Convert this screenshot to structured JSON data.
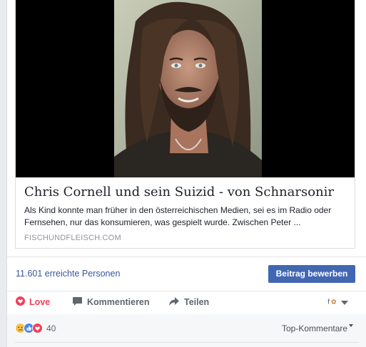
{
  "link": {
    "title": "Chris Cornell und sein Suizid - von Schnarsonir",
    "description": "Als Kind konnte man früher in den österreichischen Medien, sei es im Radio oder Fernsehen, nur das konsumieren, was gespielt wurde. Zwischen Peter ...",
    "domain": "FISCHUNDFLEISCH.COM"
  },
  "stats": {
    "reach": "11.601 erreichte Personen",
    "boost_label": "Beitrag bewerben"
  },
  "actions": {
    "love": "Love",
    "comment": "Kommentieren",
    "share": "Teilen"
  },
  "reactions": {
    "count": "40",
    "sort_label": "Top-Kommentare"
  },
  "colors": {
    "accent": "#4267b2",
    "love": "#f33e58",
    "link": "#365899"
  }
}
